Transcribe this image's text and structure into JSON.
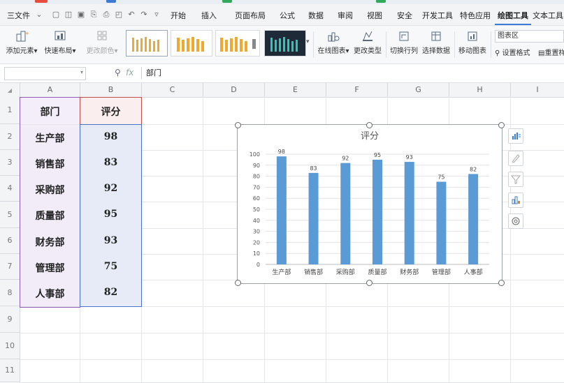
{
  "menu": {
    "file_label": "三文件",
    "tabs": [
      "开始",
      "插入",
      "页面布局",
      "公式",
      "数据",
      "审阅",
      "视图",
      "安全",
      "开发工具",
      "特色应用",
      "绘图工具",
      "文本工具"
    ]
  },
  "ribbon": {
    "add_element": "添加元素",
    "quick_layout": "快速布局",
    "change_color": "更改颜色",
    "online_chart": "在线图表",
    "change_type": "更改类型",
    "switch_row_col": "切换行列",
    "select_data": "选择数据",
    "move_chart": "移动图表",
    "chart_area_select": "图表区",
    "set_format": "设置格式",
    "reset_style": "重置样"
  },
  "formula_bar": {
    "name_box": "",
    "fx_label": "fx",
    "content": "部门"
  },
  "sheet": {
    "columns": [
      "A",
      "B",
      "C",
      "D",
      "E",
      "F",
      "G",
      "H",
      "I"
    ],
    "rows": [
      "1",
      "2",
      "3",
      "4",
      "5",
      "6",
      "7",
      "8",
      "9",
      "10",
      "11"
    ],
    "header": {
      "department": "部门",
      "score": "评分"
    },
    "records": [
      {
        "department": "生产部",
        "score": "98"
      },
      {
        "department": "销售部",
        "score": "83"
      },
      {
        "department": "采购部",
        "score": "92"
      },
      {
        "department": "质量部",
        "score": "95"
      },
      {
        "department": "财务部",
        "score": "93"
      },
      {
        "department": "管理部",
        "score": "75"
      },
      {
        "department": "人事部",
        "score": "82"
      }
    ]
  },
  "colors": {
    "bar": "#5b9bd5",
    "header_fill_a": "#f4eefa",
    "header_fill_b": "#fbeeee",
    "data_fill_a": "#f1ecf8",
    "data_fill_b": "#e6ebf7",
    "sel_border_a": "#8e5ab8",
    "sel_border_b": "#c04a4a",
    "sel_border_data": "#4a72c8"
  },
  "chart_data": {
    "type": "bar",
    "title": "评分",
    "categories": [
      "生产部",
      "销售部",
      "采购部",
      "质量部",
      "财务部",
      "管理部",
      "人事部"
    ],
    "values": [
      98,
      83,
      92,
      95,
      93,
      75,
      82
    ],
    "yticks": [
      "0",
      "10",
      "20",
      "30",
      "40",
      "50",
      "60",
      "70",
      "80",
      "90",
      "100"
    ],
    "ylim": [
      0,
      100
    ],
    "grid": true,
    "legend": "none",
    "data_labels": [
      "98",
      "83",
      "92",
      "95",
      "93",
      "75",
      "82"
    ]
  }
}
